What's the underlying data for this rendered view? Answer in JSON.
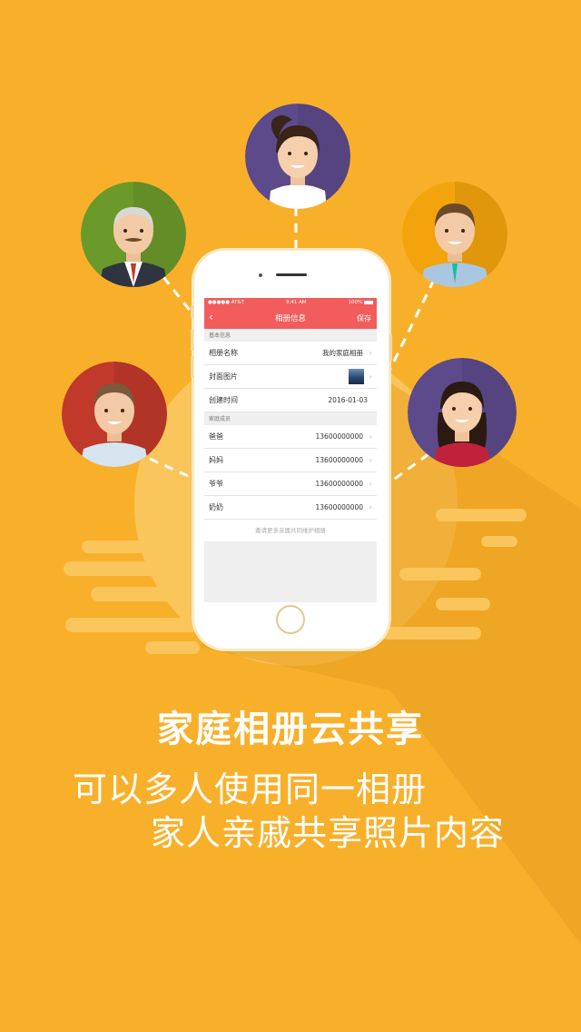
{
  "colors": {
    "background": "#F8B02B",
    "accent_red": "#F25C5C",
    "text_white": "#FFFFFF"
  },
  "avatars": [
    {
      "name": "woman-top",
      "bg": "#5D4A8B"
    },
    {
      "name": "grandfather",
      "bg": "#6C9A2A"
    },
    {
      "name": "young-man",
      "bg": "#F3A40C"
    },
    {
      "name": "man-left",
      "bg": "#C0392B"
    },
    {
      "name": "woman-right",
      "bg": "#5D4A8B"
    }
  ],
  "status_bar": {
    "carrier": "●●●●● AT&T",
    "time": "9:41 AM",
    "battery": "100%"
  },
  "navbar": {
    "back_icon": "chevron-left-icon",
    "title": "相册信息",
    "save_label": "保存"
  },
  "basic_info": {
    "section_title": "基本信息",
    "album_name_label": "相册名称",
    "album_name_value": "我的家庭相册",
    "cover_label": "封面图片",
    "created_label": "创建时间",
    "created_value": "2016-01-03"
  },
  "members": {
    "section_title": "家庭成员",
    "items": [
      {
        "name": "爸爸",
        "phone": "13600000000"
      },
      {
        "name": "妈妈",
        "phone": "13600000000"
      },
      {
        "name": "爷爷",
        "phone": "13600000000"
      },
      {
        "name": "奶奶",
        "phone": "13600000000"
      }
    ],
    "invite_text": "邀请更多亲属共同维护相册"
  },
  "marketing": {
    "headline": "家庭相册云共享",
    "line1": "可以多人使用同一相册",
    "line2": "家人亲戚共享照片内容"
  }
}
